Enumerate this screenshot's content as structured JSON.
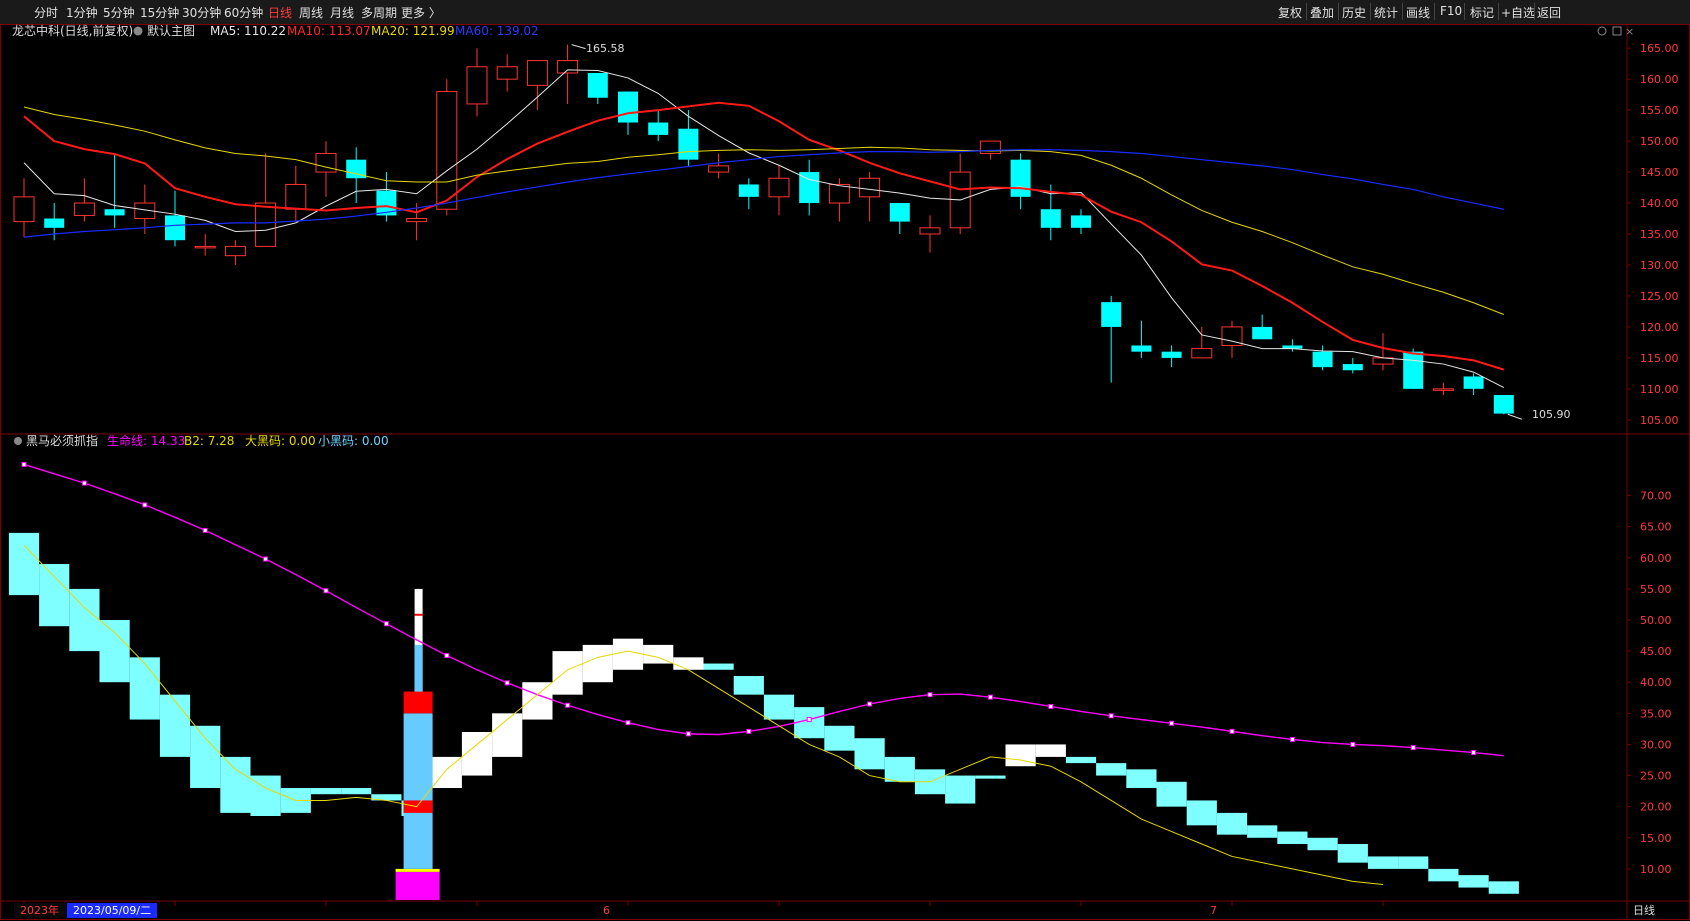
{
  "toolbar": {
    "periods": [
      "分时",
      "1分钟",
      "5分钟",
      "15分钟",
      "30分钟",
      "60分钟",
      "日线",
      "周线",
      "月线",
      "多周期",
      "更多 〉"
    ],
    "active_period": "日线",
    "right_buttons": [
      "复权",
      "叠加",
      "历史",
      "统计",
      "画线",
      "F10",
      "标记",
      "+自选",
      "返回"
    ]
  },
  "main_header": {
    "stock": "龙芯中科(日线,前复权)",
    "template": "默认主图",
    "ma5": "MA5: 110.22",
    "ma10": "MA10: 113.07",
    "ma20": "MA20: 121.99",
    "ma60": "MA60: 139.02"
  },
  "sub_header": {
    "name": "黑马必须抓指",
    "life": "生命线: 14.33",
    "b2": "B2: 7.28",
    "big": "大黑码: 0.00",
    "small": "小黑码: 0.00"
  },
  "annotations": {
    "high": "165.58",
    "low": "105.90"
  },
  "bottom_bar": {
    "year": "2023年",
    "date": "2023/05/09/二",
    "m6": "6",
    "m7": "7",
    "period": "日线"
  },
  "colors": {
    "up": "#ff3333",
    "down": "#00ffff",
    "ma5": "#e6e6e6",
    "ma10": "#ff1a1a",
    "ma20": "#e6d800",
    "ma60": "#1a2bff",
    "life": "#ff00ff",
    "band": "#7fffff",
    "bg": "#000000"
  },
  "chart_data": [
    {
      "type": "candlestick",
      "title": "龙芯中科(日线,前复权)",
      "ylim": [
        104,
        166
      ],
      "yticks": [
        105,
        110,
        115,
        120,
        125,
        130,
        135,
        140,
        145,
        150,
        155,
        160,
        165
      ],
      "ohlc": [
        [
          137,
          141,
          144,
          134.5
        ],
        [
          137.5,
          136,
          140,
          134
        ],
        [
          138,
          140,
          144,
          137
        ],
        [
          139,
          138,
          148,
          136
        ],
        [
          137.5,
          140,
          143,
          135
        ],
        [
          138,
          134,
          142,
          133
        ],
        [
          133,
          133,
          135,
          131.5
        ],
        [
          131.5,
          133,
          134,
          130
        ],
        [
          133,
          140,
          148,
          133
        ],
        [
          139,
          143,
          146,
          137
        ],
        [
          145,
          148,
          150,
          141
        ],
        [
          147,
          144,
          149,
          140
        ],
        [
          142,
          138,
          145,
          137
        ],
        [
          137,
          137.5,
          140,
          134
        ],
        [
          139,
          158,
          160,
          138
        ],
        [
          156,
          162,
          165,
          154
        ],
        [
          160,
          162,
          164,
          158
        ],
        [
          159,
          163,
          163,
          155
        ],
        [
          161,
          163,
          165.58,
          156
        ],
        [
          161,
          157,
          160,
          156
        ],
        [
          158,
          153,
          158,
          151
        ],
        [
          153,
          151,
          155,
          150
        ],
        [
          152,
          147,
          155,
          146
        ],
        [
          145,
          146,
          148,
          144
        ],
        [
          143,
          141,
          144,
          139
        ],
        [
          141,
          144,
          146,
          138
        ],
        [
          145,
          140,
          147,
          138
        ],
        [
          140,
          143,
          144,
          137
        ],
        [
          141,
          144,
          145,
          137
        ],
        [
          140,
          137,
          140,
          135
        ],
        [
          135,
          136,
          138,
          132
        ],
        [
          136,
          145,
          148,
          135
        ],
        [
          148,
          150,
          150,
          147
        ],
        [
          147,
          141,
          148,
          139
        ],
        [
          139,
          136,
          143,
          134
        ],
        [
          138,
          136,
          139,
          135
        ],
        [
          124,
          120,
          125,
          111
        ],
        [
          117,
          116,
          121,
          115
        ],
        [
          116,
          115,
          117,
          113.5
        ],
        [
          115,
          116.5,
          120,
          115
        ],
        [
          117,
          120,
          121,
          115
        ],
        [
          120,
          118,
          122,
          118
        ],
        [
          117,
          116.5,
          118,
          116
        ],
        [
          116,
          113.5,
          117,
          113
        ],
        [
          114,
          113,
          115,
          112.5
        ],
        [
          114,
          115,
          119,
          113
        ],
        [
          116,
          110,
          116.5,
          110
        ],
        [
          110,
          110,
          111,
          109
        ],
        [
          112,
          110,
          112.5,
          109
        ],
        [
          109,
          106,
          109,
          105.9
        ]
      ],
      "series": [
        {
          "name": "MA5",
          "values": [
            146.5,
            141.5,
            141.2,
            139.6,
            138.9,
            138.2,
            137.2,
            135.4,
            135.6,
            136.8,
            139.5,
            141.9,
            142.2,
            141.5,
            145.2,
            148.7,
            152.8,
            157.1,
            161.5,
            161.4,
            160.2,
            157.7,
            154,
            150.9,
            148.1,
            146.1,
            143.8,
            142.8,
            142.2,
            141.6,
            140.8,
            140.5,
            142.2,
            142.6,
            141.5,
            141.7,
            136.6,
            131.6,
            124.7,
            118.7,
            117.7,
            116.5,
            116.5,
            116.1,
            116,
            115,
            114.6,
            114,
            112.7,
            110.2
          ]
        },
        {
          "name": "MA10",
          "values": [
            154,
            150,
            148.7,
            147.9,
            146.4,
            142.4,
            141,
            139.8,
            139.4,
            139.1,
            138.8,
            139.2,
            139.5,
            138.5,
            140.4,
            144.2,
            147.1,
            149.6,
            151.5,
            153.3,
            154.5,
            155,
            155.6,
            156.2,
            155.7,
            153.2,
            150.2,
            148.5,
            146.5,
            144.8,
            143.5,
            142.2,
            142.5,
            142.4,
            141.8,
            141.3,
            138.6,
            136.9,
            133.8,
            130.1,
            129.1,
            126.6,
            123.9,
            120.8,
            117.9,
            116.6,
            115.7,
            115.3,
            114.6,
            113.1
          ]
        },
        {
          "name": "MA20",
          "values": [
            155.5,
            154.3,
            153.5,
            152.6,
            151.6,
            150.2,
            148.9,
            148,
            147.6,
            147,
            145.8,
            144.7,
            143.6,
            143.4,
            143.4,
            144.5,
            145.2,
            145.8,
            146.4,
            146.7,
            147.4,
            147.8,
            148.3,
            148.5,
            148.6,
            148.5,
            148.6,
            148.8,
            149,
            148.9,
            148.6,
            148.5,
            148.4,
            148.5,
            148.3,
            147.7,
            146.1,
            144,
            141.3,
            138.8,
            136.9,
            135.4,
            133.6,
            131.6,
            129.7,
            128.5,
            127,
            125.6,
            123.9,
            122
          ]
        },
        {
          "name": "MA60",
          "values": [
            134.5,
            135,
            135.4,
            135.7,
            136,
            136.4,
            136.6,
            136.8,
            136.8,
            137.1,
            137.4,
            137.9,
            138.5,
            139.2,
            140,
            140.9,
            141.8,
            142.6,
            143.4,
            144.1,
            144.7,
            145.3,
            145.9,
            146.5,
            147,
            147.5,
            147.8,
            148.1,
            148.3,
            148.3,
            148.2,
            148.3,
            148.5,
            148.6,
            148.6,
            148.5,
            148.3,
            148,
            147.5,
            147,
            146.5,
            146,
            145.4,
            144.6,
            143.9,
            143,
            142.2,
            141,
            140,
            139
          ]
        }
      ]
    },
    {
      "type": "area",
      "title": "黑马必须抓指",
      "ylim": [
        5,
        77
      ],
      "yticks": [
        10,
        15,
        20,
        25,
        30,
        35,
        40,
        45,
        50,
        55,
        60,
        65,
        70
      ],
      "band": [
        [
          64,
          54,
          "c"
        ],
        [
          59,
          49,
          "c"
        ],
        [
          55,
          45,
          "c"
        ],
        [
          50,
          40,
          "c"
        ],
        [
          44,
          34,
          "c"
        ],
        [
          38,
          28,
          "c"
        ],
        [
          33,
          23,
          "c"
        ],
        [
          28,
          19,
          "c"
        ],
        [
          25,
          18.5,
          "c"
        ],
        [
          23,
          19,
          "c"
        ],
        [
          23,
          22,
          "c"
        ],
        [
          23,
          22,
          "c"
        ],
        [
          22,
          21,
          "c"
        ],
        [
          21,
          18.5,
          "c"
        ],
        [
          28,
          23,
          "w"
        ],
        [
          32,
          25,
          "w"
        ],
        [
          35,
          28,
          "w"
        ],
        [
          40,
          34,
          "w"
        ],
        [
          45,
          38,
          "w"
        ],
        [
          46,
          40,
          "w"
        ],
        [
          47,
          42,
          "w"
        ],
        [
          46,
          43,
          "w"
        ],
        [
          44,
          42,
          "w"
        ],
        [
          43,
          42,
          "c"
        ],
        [
          41,
          38,
          "c"
        ],
        [
          38,
          34,
          "c"
        ],
        [
          36,
          31,
          "c"
        ],
        [
          33,
          29,
          "c"
        ],
        [
          31,
          26,
          "c"
        ],
        [
          28,
          24,
          "c"
        ],
        [
          26,
          22,
          "c"
        ],
        [
          25,
          20.5,
          "c"
        ],
        [
          25,
          24.5,
          "c"
        ],
        [
          30,
          26.5,
          "w"
        ],
        [
          30,
          28,
          "w"
        ],
        [
          28,
          27,
          "c"
        ],
        [
          27,
          25,
          "c"
        ],
        [
          26,
          23,
          "c"
        ],
        [
          24,
          20,
          "c"
        ],
        [
          21,
          17,
          "c"
        ],
        [
          19,
          15.5,
          "c"
        ],
        [
          17,
          15,
          "c"
        ],
        [
          16,
          14,
          "c"
        ],
        [
          15,
          13,
          "c"
        ],
        [
          14,
          11,
          "c"
        ],
        [
          12,
          10,
          "c"
        ],
        [
          12,
          10,
          "c"
        ],
        [
          10,
          8,
          "c"
        ],
        [
          9,
          7,
          "c"
        ],
        [
          8,
          6,
          "c"
        ]
      ],
      "series": [
        {
          "name": "生命线",
          "values": [
            75,
            73.5,
            72,
            70.3,
            68.5,
            66.5,
            64.4,
            62.1,
            59.8,
            57.3,
            54.7,
            52,
            49.4,
            46.8,
            44.3,
            42,
            39.9,
            38,
            36.3,
            34.8,
            33.5,
            32.4,
            31.7,
            31.6,
            32.1,
            32.9,
            34,
            35.3,
            36.5,
            37.4,
            38,
            38.1,
            37.6,
            36.9,
            36.1,
            35.3,
            34.6,
            34,
            33.4,
            32.8,
            32.1,
            31.4,
            30.8,
            30.3,
            30,
            29.8,
            29.5,
            29.1,
            28.7,
            28.2
          ]
        },
        {
          "name": "B2",
          "values": [
            62,
            57,
            52,
            48,
            43,
            37,
            31,
            26,
            23,
            21,
            21,
            21.5,
            21,
            20,
            26,
            30,
            34,
            38,
            42,
            44,
            45,
            44,
            42,
            39,
            36,
            33,
            30,
            28,
            25,
            24,
            24,
            26,
            28,
            27.5,
            26.5,
            24,
            21,
            18,
            16,
            14,
            12,
            11,
            10,
            9,
            8,
            7.5
          ]
        }
      ],
      "volume_bar": {
        "life_value": 14.33,
        "b2_value": 7.28,
        "big_black": 0.0,
        "small_black": 0.0
      }
    }
  ]
}
